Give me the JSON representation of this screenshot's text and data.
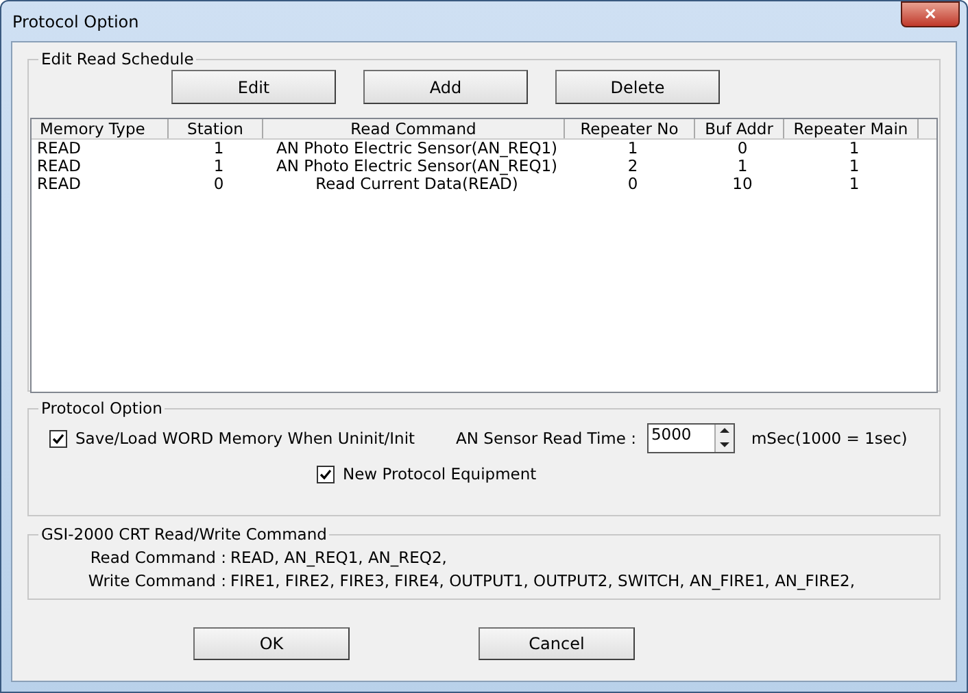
{
  "window": {
    "title": "Protocol Option",
    "close": "✕"
  },
  "schedule": {
    "title": "Edit Read Schedule",
    "buttons": [
      "Edit",
      "Add",
      "Delete"
    ],
    "columns": [
      "Memory Type",
      "Station",
      "Read Command",
      "Repeater No",
      "Buf Addr",
      "Repeater Main"
    ],
    "rows": [
      [
        "READ",
        "1",
        "AN Photo Electric Sensor(AN_REQ1)",
        "1",
        "0",
        "1"
      ],
      [
        "READ",
        "1",
        "AN Photo Electric Sensor(AN_REQ1)",
        "2",
        "1",
        "1"
      ],
      [
        "READ",
        "0",
        "Read Current Data(READ)",
        "0",
        "10",
        "1"
      ]
    ]
  },
  "protocol": {
    "title": "Protocol Option",
    "save_load": {
      "label": "Save/Load WORD Memory When Uninit/Init",
      "checked": true
    },
    "read_time_label": "AN Sensor Read Time :",
    "read_time_value": "5000",
    "unit": "mSec(1000 = 1sec)",
    "new_protocol": {
      "label": "New Protocol Equipment",
      "checked": true
    }
  },
  "commands": {
    "title": "GSI-2000 CRT Read/Write Command",
    "lines": [
      {
        "label": "Read Command :",
        "value": "READ, AN_REQ1, AN_REQ2,"
      },
      {
        "label": "Write Command :",
        "value": "FIRE1, FIRE2, FIRE3, FIRE4, OUTPUT1, OUTPUT2, SWITCH, AN_FIRE1, AN_FIRE2,"
      }
    ]
  },
  "buttons": [
    "OK",
    "Cancel"
  ]
}
